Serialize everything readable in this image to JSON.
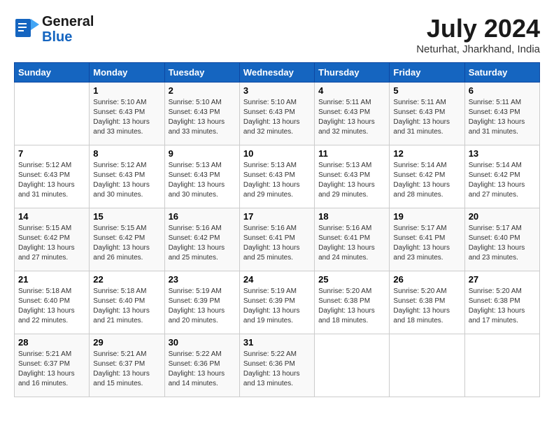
{
  "header": {
    "logo_line1": "General",
    "logo_line2": "Blue",
    "month_year": "July 2024",
    "location": "Neturhat, Jharkhand, India"
  },
  "days_of_week": [
    "Sunday",
    "Monday",
    "Tuesday",
    "Wednesday",
    "Thursday",
    "Friday",
    "Saturday"
  ],
  "weeks": [
    [
      {
        "day": "",
        "detail": ""
      },
      {
        "day": "1",
        "detail": "Sunrise: 5:10 AM\nSunset: 6:43 PM\nDaylight: 13 hours\nand 33 minutes."
      },
      {
        "day": "2",
        "detail": "Sunrise: 5:10 AM\nSunset: 6:43 PM\nDaylight: 13 hours\nand 33 minutes."
      },
      {
        "day": "3",
        "detail": "Sunrise: 5:10 AM\nSunset: 6:43 PM\nDaylight: 13 hours\nand 32 minutes."
      },
      {
        "day": "4",
        "detail": "Sunrise: 5:11 AM\nSunset: 6:43 PM\nDaylight: 13 hours\nand 32 minutes."
      },
      {
        "day": "5",
        "detail": "Sunrise: 5:11 AM\nSunset: 6:43 PM\nDaylight: 13 hours\nand 31 minutes."
      },
      {
        "day": "6",
        "detail": "Sunrise: 5:11 AM\nSunset: 6:43 PM\nDaylight: 13 hours\nand 31 minutes."
      }
    ],
    [
      {
        "day": "7",
        "detail": ""
      },
      {
        "day": "8",
        "detail": "Sunrise: 5:12 AM\nSunset: 6:43 PM\nDaylight: 13 hours\nand 30 minutes."
      },
      {
        "day": "9",
        "detail": "Sunrise: 5:13 AM\nSunset: 6:43 PM\nDaylight: 13 hours\nand 30 minutes."
      },
      {
        "day": "10",
        "detail": "Sunrise: 5:13 AM\nSunset: 6:43 PM\nDaylight: 13 hours\nand 29 minutes."
      },
      {
        "day": "11",
        "detail": "Sunrise: 5:13 AM\nSunset: 6:43 PM\nDaylight: 13 hours\nand 29 minutes."
      },
      {
        "day": "12",
        "detail": "Sunrise: 5:14 AM\nSunset: 6:42 PM\nDaylight: 13 hours\nand 28 minutes."
      },
      {
        "day": "13",
        "detail": "Sunrise: 5:14 AM\nSunset: 6:42 PM\nDaylight: 13 hours\nand 27 minutes."
      }
    ],
    [
      {
        "day": "14",
        "detail": ""
      },
      {
        "day": "15",
        "detail": "Sunrise: 5:15 AM\nSunset: 6:42 PM\nDaylight: 13 hours\nand 26 minutes."
      },
      {
        "day": "16",
        "detail": "Sunrise: 5:16 AM\nSunset: 6:42 PM\nDaylight: 13 hours\nand 25 minutes."
      },
      {
        "day": "17",
        "detail": "Sunrise: 5:16 AM\nSunset: 6:41 PM\nDaylight: 13 hours\nand 25 minutes."
      },
      {
        "day": "18",
        "detail": "Sunrise: 5:16 AM\nSunset: 6:41 PM\nDaylight: 13 hours\nand 24 minutes."
      },
      {
        "day": "19",
        "detail": "Sunrise: 5:17 AM\nSunset: 6:41 PM\nDaylight: 13 hours\nand 23 minutes."
      },
      {
        "day": "20",
        "detail": "Sunrise: 5:17 AM\nSunset: 6:40 PM\nDaylight: 13 hours\nand 23 minutes."
      }
    ],
    [
      {
        "day": "21",
        "detail": ""
      },
      {
        "day": "22",
        "detail": "Sunrise: 5:18 AM\nSunset: 6:40 PM\nDaylight: 13 hours\nand 21 minutes."
      },
      {
        "day": "23",
        "detail": "Sunrise: 5:19 AM\nSunset: 6:39 PM\nDaylight: 13 hours\nand 20 minutes."
      },
      {
        "day": "24",
        "detail": "Sunrise: 5:19 AM\nSunset: 6:39 PM\nDaylight: 13 hours\nand 19 minutes."
      },
      {
        "day": "25",
        "detail": "Sunrise: 5:20 AM\nSunset: 6:38 PM\nDaylight: 13 hours\nand 18 minutes."
      },
      {
        "day": "26",
        "detail": "Sunrise: 5:20 AM\nSunset: 6:38 PM\nDaylight: 13 hours\nand 18 minutes."
      },
      {
        "day": "27",
        "detail": "Sunrise: 5:20 AM\nSunset: 6:38 PM\nDaylight: 13 hours\nand 17 minutes."
      }
    ],
    [
      {
        "day": "28",
        "detail": "Sunrise: 5:21 AM\nSunset: 6:37 PM\nDaylight: 13 hours\nand 16 minutes."
      },
      {
        "day": "29",
        "detail": "Sunrise: 5:21 AM\nSunset: 6:37 PM\nDaylight: 13 hours\nand 15 minutes."
      },
      {
        "day": "30",
        "detail": "Sunrise: 5:22 AM\nSunset: 6:36 PM\nDaylight: 13 hours\nand 14 minutes."
      },
      {
        "day": "31",
        "detail": "Sunrise: 5:22 AM\nSunset: 6:36 PM\nDaylight: 13 hours\nand 13 minutes."
      },
      {
        "day": "",
        "detail": ""
      },
      {
        "day": "",
        "detail": ""
      },
      {
        "day": "",
        "detail": ""
      }
    ]
  ],
  "week1_sun_detail": "Sunrise: 5:12 AM\nSunset: 6:43 PM\nDaylight: 13 hours\nand 31 minutes.",
  "week2_sun_detail": "Sunrise: 5:12 AM\nSunset: 6:43 PM\nDaylight: 13 hours\nand 31 minutes.",
  "week3_sun_detail": "Sunrise: 5:15 AM\nSunset: 6:42 PM\nDaylight: 13 hours\nand 27 minutes.",
  "week4_sun_detail": "Sunrise: 5:18 AM\nSunset: 6:40 PM\nDaylight: 13 hours\nand 22 minutes."
}
